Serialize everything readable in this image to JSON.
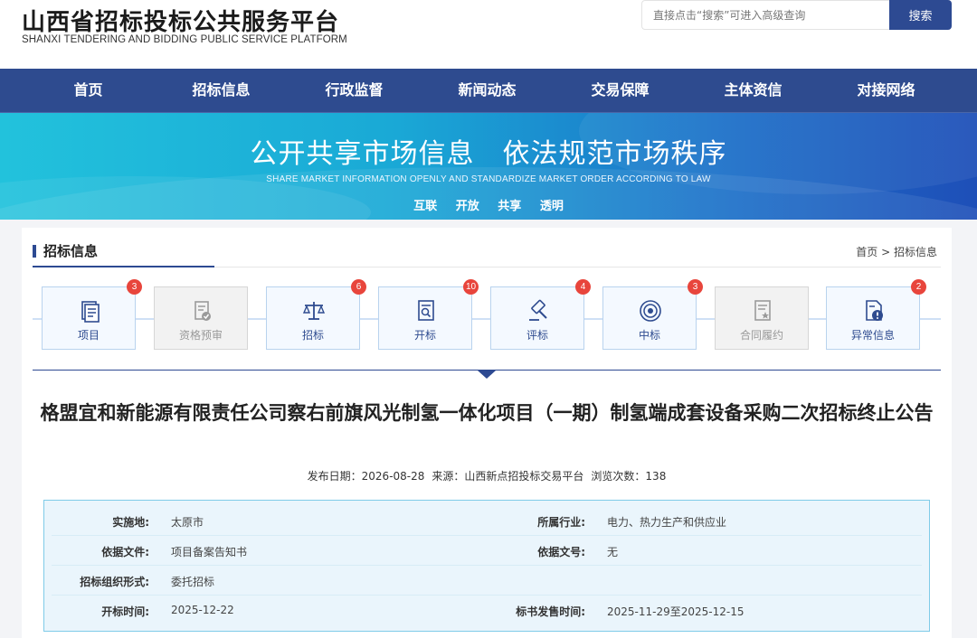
{
  "header": {
    "logo_cn": "山西省招标投标公共服务平台",
    "logo_en": "SHANXI TENDERING AND BIDDING PUBLIC SERVICE PLATFORM",
    "search_placeholder": "直接点击“搜索”可进入高级查询",
    "search_button": "搜索"
  },
  "nav": [
    "首页",
    "招标信息",
    "行政监督",
    "新闻动态",
    "交易保障",
    "主体资信",
    "对接网络"
  ],
  "banner": {
    "title": "公开共享市场信息　依法规范市场秩序",
    "subtitle": "SHARE MARKET INFORMATION OPENLY AND STANDARDIZE MARKET ORDER ACCORDING TO LAW",
    "tags": [
      "互联",
      "开放",
      "共享",
      "透明"
    ]
  },
  "section": {
    "title": "招标信息",
    "breadcrumb_home": "首页",
    "breadcrumb_sep": " > ",
    "breadcrumb_current": "招标信息"
  },
  "steps": [
    {
      "label": "项目",
      "badge": "3",
      "icon": "document-list-icon",
      "enabled": true
    },
    {
      "label": "资格预审",
      "badge": "",
      "icon": "document-check-icon",
      "enabled": false
    },
    {
      "label": "招标",
      "badge": "6",
      "icon": "scales-icon",
      "enabled": true
    },
    {
      "label": "开标",
      "badge": "10",
      "icon": "document-search-icon",
      "enabled": true
    },
    {
      "label": "评标",
      "badge": "4",
      "icon": "gavel-icon",
      "enabled": true
    },
    {
      "label": "中标",
      "badge": "3",
      "icon": "target-icon",
      "enabled": true
    },
    {
      "label": "合同履约",
      "badge": "",
      "icon": "contract-star-icon",
      "enabled": false
    },
    {
      "label": "异常信息",
      "badge": "2",
      "icon": "document-alert-icon",
      "enabled": true
    }
  ],
  "article": {
    "title": "格盟宜和新能源有限责任公司察右前旗风光制氢一体化项目（一期）制氢端成套设备采购二次招标终止公告",
    "publish_date": "发布日期：2026-08-28",
    "source": "来源：山西新点招投标交易平台",
    "views": "浏览次数：138"
  },
  "info": {
    "impl_label": "实施地:",
    "impl_value": "太原市",
    "industry_label": "所属行业:",
    "industry_value": "电力、热力生产和供应业",
    "basis_label": "依据文件:",
    "basis_value": "项目备案告知书",
    "doc_no_label": "依据文号:",
    "doc_no_value": "无",
    "org_label": "招标组织形式:",
    "org_value": "委托招标",
    "open_label": "开标时间:",
    "open_value": "2025-12-22",
    "sale_label": "标书发售时间:",
    "sale_value": "2025-11-29至2025-12-15"
  },
  "colors": {
    "nav_bg": "#2e4b8f",
    "accent": "#2d4a92",
    "badge": "#e8453c",
    "info_bg": "#eaf5fc",
    "info_border": "#7fcbe8"
  }
}
